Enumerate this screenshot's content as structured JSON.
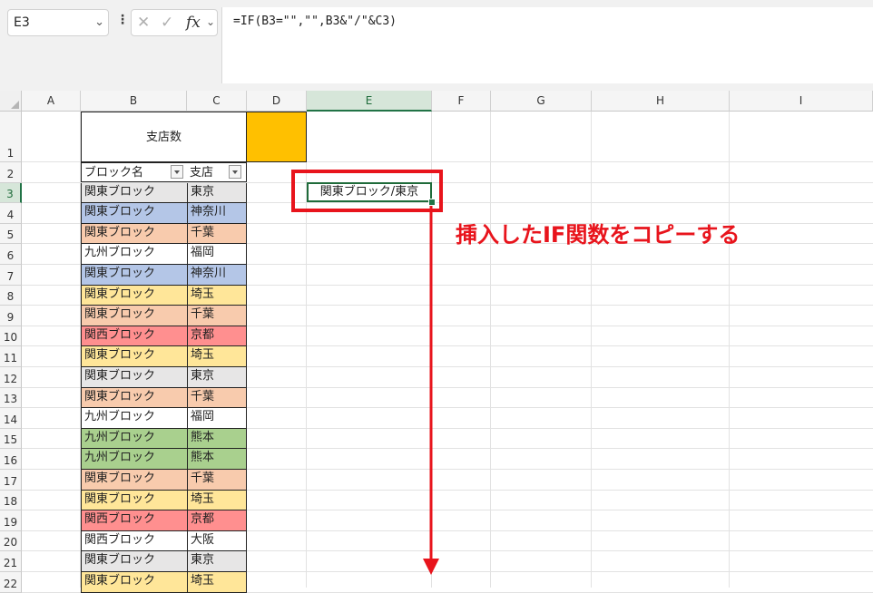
{
  "name_box": {
    "value": "E3"
  },
  "formula_bar": {
    "cancel_glyph": "✕",
    "enter_glyph": "✓",
    "fx_label": "fx",
    "formula": "=IF(B3=\"\",\"\",B3&\"/\"&C3)"
  },
  "columns": [
    "A",
    "B",
    "C",
    "D",
    "E",
    "F",
    "G",
    "H",
    "I"
  ],
  "selected_column": "E",
  "rows": [
    "1",
    "2",
    "3",
    "4",
    "5",
    "6",
    "7",
    "8",
    "9",
    "10",
    "11",
    "12",
    "13",
    "14",
    "15",
    "16",
    "17",
    "18",
    "19",
    "20",
    "21",
    "22"
  ],
  "selected_row": "3",
  "title_cell": "支店数",
  "table_headers": [
    "ブロック名",
    "支店"
  ],
  "table_rows": [
    {
      "block": "関東ブロック",
      "branch": "東京",
      "color": "#e7e6e6"
    },
    {
      "block": "関東ブロック",
      "branch": "神奈川",
      "color": "#b4c6e7"
    },
    {
      "block": "関東ブロック",
      "branch": "千葉",
      "color": "#f8cbad"
    },
    {
      "block": "九州ブロック",
      "branch": "福岡",
      "color": "#ffffff"
    },
    {
      "block": "関東ブロック",
      "branch": "神奈川",
      "color": "#b4c6e7"
    },
    {
      "block": "関東ブロック",
      "branch": "埼玉",
      "color": "#ffe699"
    },
    {
      "block": "関東ブロック",
      "branch": "千葉",
      "color": "#f8cbad"
    },
    {
      "block": "関西ブロック",
      "branch": "京都",
      "color": "#ff8f8f"
    },
    {
      "block": "関東ブロック",
      "branch": "埼玉",
      "color": "#ffe699"
    },
    {
      "block": "関東ブロック",
      "branch": "東京",
      "color": "#e7e6e6"
    },
    {
      "block": "関東ブロック",
      "branch": "千葉",
      "color": "#f8cbad"
    },
    {
      "block": "九州ブロック",
      "branch": "福岡",
      "color": "#ffffff"
    },
    {
      "block": "九州ブロック",
      "branch": "熊本",
      "color": "#a9d08e"
    },
    {
      "block": "九州ブロック",
      "branch": "熊本",
      "color": "#a9d08e"
    },
    {
      "block": "関東ブロック",
      "branch": "千葉",
      "color": "#f8cbad"
    },
    {
      "block": "関東ブロック",
      "branch": "埼玉",
      "color": "#ffe699"
    },
    {
      "block": "関西ブロック",
      "branch": "京都",
      "color": "#ff8f8f"
    },
    {
      "block": "関西ブロック",
      "branch": "大阪",
      "color": "#ffffff"
    },
    {
      "block": "関東ブロック",
      "branch": "東京",
      "color": "#e7e6e6"
    },
    {
      "block": "関東ブロック",
      "branch": "埼玉",
      "color": "#ffe699"
    }
  ],
  "d1_fill_color": "#ffc000",
  "active_cell": {
    "value": "関東ブロック/東京"
  },
  "annotation": {
    "text": "挿入したIF関数をコピーする",
    "color": "#e8141c"
  }
}
